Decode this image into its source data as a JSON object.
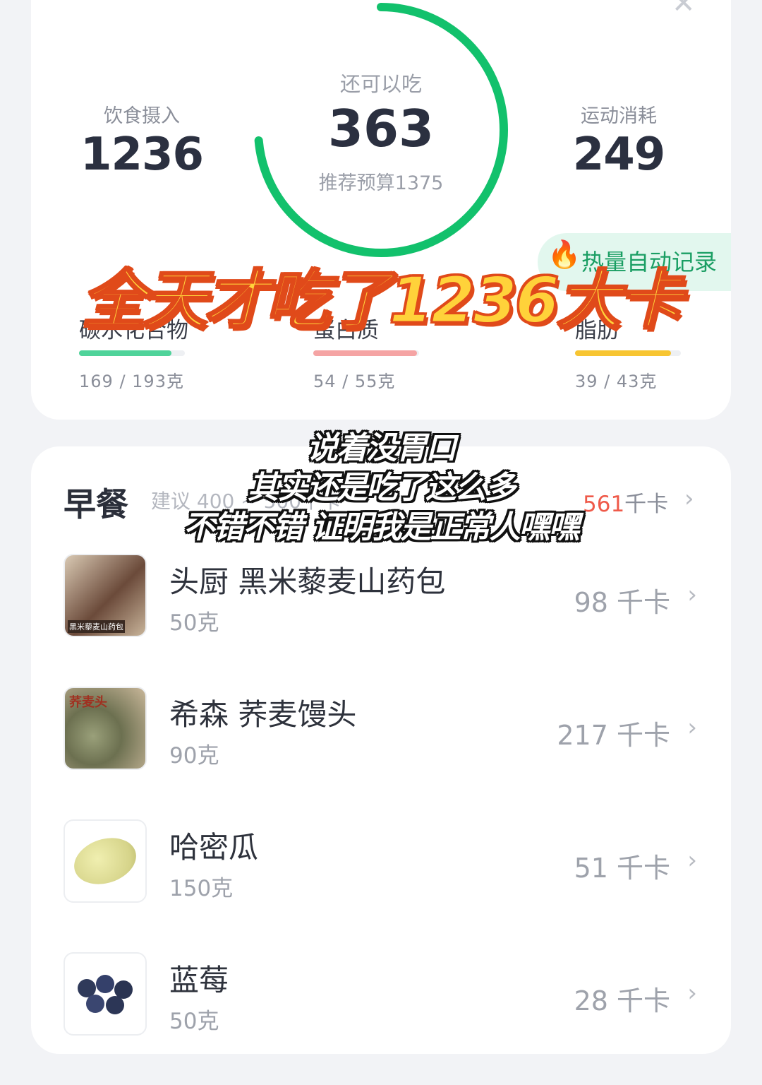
{
  "summary": {
    "close_icon": "close-icon",
    "intake_label": "饮食摄入",
    "intake_value": "1236",
    "remaining_label": "还可以吃",
    "remaining_value": "363",
    "budget_label": "推荐预算1375",
    "burn_label": "运动消耗",
    "burn_value": "249",
    "ring_progress": 0.736,
    "ring_color": "#12c16c",
    "auto_record": "热量自动记录"
  },
  "macros": [
    {
      "label": "碳水化合物",
      "value": "169 / 193克",
      "fraction": 0.876,
      "color": "#4fd39a"
    },
    {
      "label": "蛋白质",
      "value": "54 / 55克",
      "fraction": 0.98,
      "color": "#f5a4a4"
    },
    {
      "label": "脂肪",
      "value": "39 / 43克",
      "fraction": 0.907,
      "color": "#f7c532"
    }
  ],
  "overlay": {
    "title": "全天才吃了1236大卡",
    "captions": [
      "说着没胃口",
      "其实还是吃了这么多",
      "不错不错 证明我是正常人嘿嘿"
    ]
  },
  "meal": {
    "title": "早餐",
    "hint": "建议 400 ~ 500千卡",
    "total_num": "561",
    "total_unit": "千卡"
  },
  "foods": [
    {
      "name": "头厨 黑米藜麦山药包",
      "weight": "50克",
      "kcal": "98 千卡",
      "thumb_text": "黑米藜麦山药包"
    },
    {
      "name": "希森 荞麦馒头",
      "weight": "90克",
      "kcal": "217 千卡",
      "thumb_text": "荞麦头"
    },
    {
      "name": "哈密瓜",
      "weight": "150克",
      "kcal": "51 千卡",
      "thumb_text": ""
    },
    {
      "name": "蓝莓",
      "weight": "50克",
      "kcal": "28 千卡",
      "thumb_text": ""
    }
  ]
}
